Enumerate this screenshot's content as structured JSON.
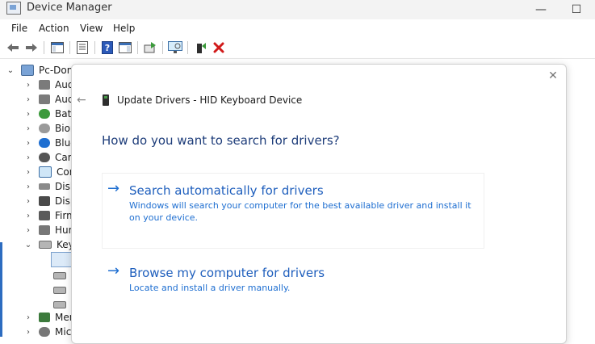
{
  "window": {
    "title": "Device Manager",
    "minimize_glyph": "—",
    "maximize_glyph": "☐"
  },
  "menu": {
    "items": [
      "File",
      "Action",
      "View",
      "Help"
    ]
  },
  "toolbar": {
    "icons": [
      "back-icon",
      "forward-icon",
      "properties-icon",
      "show-hide-console-tree-icon",
      "help-icon",
      "action-pane-icon",
      "update-driver-icon",
      "scan-hardware-icon",
      "enable-device-icon",
      "uninstall-device-icon"
    ]
  },
  "tree": {
    "root": "Pc-Dom",
    "items": [
      {
        "label": "Aud",
        "expanded": false
      },
      {
        "label": "Aud",
        "expanded": false
      },
      {
        "label": "Batt",
        "expanded": false
      },
      {
        "label": "Biom",
        "expanded": false
      },
      {
        "label": "Blue",
        "expanded": false
      },
      {
        "label": "Cam",
        "expanded": false
      },
      {
        "label": "Com",
        "expanded": false
      },
      {
        "label": "Disk",
        "expanded": false
      },
      {
        "label": "Disp",
        "expanded": false
      },
      {
        "label": "Firm",
        "expanded": false
      },
      {
        "label": "Hum",
        "expanded": false
      },
      {
        "label": "Key",
        "expanded": true
      },
      {
        "label": "Men",
        "expanded": false
      },
      {
        "label": "Mic",
        "expanded": false
      }
    ]
  },
  "dialog": {
    "title": "Update Drivers - HID Keyboard Device",
    "heading": "How do you want to search for drivers?",
    "options": [
      {
        "title": "Search automatically for drivers",
        "description": "Windows will search your computer for the best available driver and install it on your device."
      },
      {
        "title": "Browse my computer for drivers",
        "description": "Locate and install a driver manually."
      }
    ],
    "close_glyph": "✕",
    "back_glyph": "←",
    "option_arrow_glyph": "→"
  },
  "colors": {
    "accent": "#1f6fd1",
    "heading": "#1e3d7a",
    "selection": "#dceaf8"
  }
}
